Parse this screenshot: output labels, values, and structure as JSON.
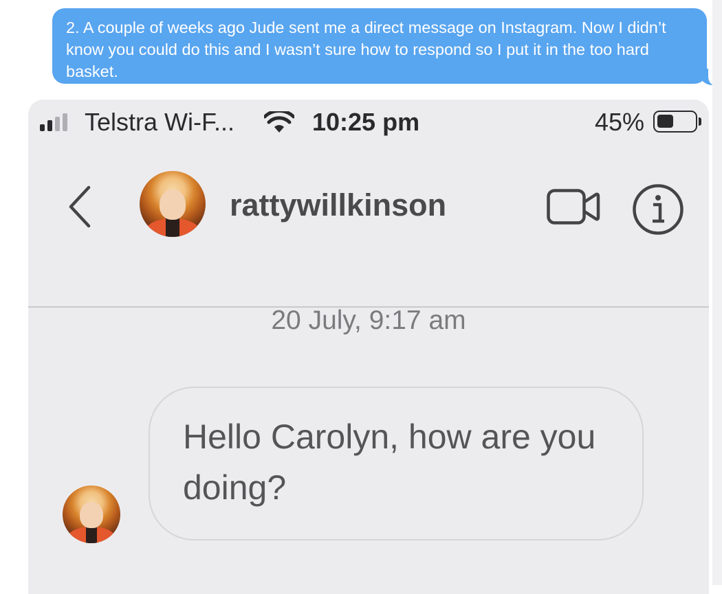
{
  "imessage": {
    "text": "2. A couple of weeks ago Jude sent me a direct message on Instagram. Now I didn’t know you could do this and I wasn’t sure how to respond so I put it in the too hard basket.",
    "color": "#58a5f0"
  },
  "status_bar": {
    "carrier": "Telstra Wi-F...",
    "time": "10:25 pm",
    "battery_percent": "45%",
    "signal_bars": 2,
    "battery_level": 0.45
  },
  "header": {
    "username": "rattywillkinson",
    "back_icon": "chevron-left-icon",
    "video_icon": "video-camera-icon",
    "info_icon": "info-icon"
  },
  "chat": {
    "date": "20 July, 9:17 am",
    "messages": [
      {
        "text": "Hello Carolyn, how are you doing?"
      }
    ]
  }
}
